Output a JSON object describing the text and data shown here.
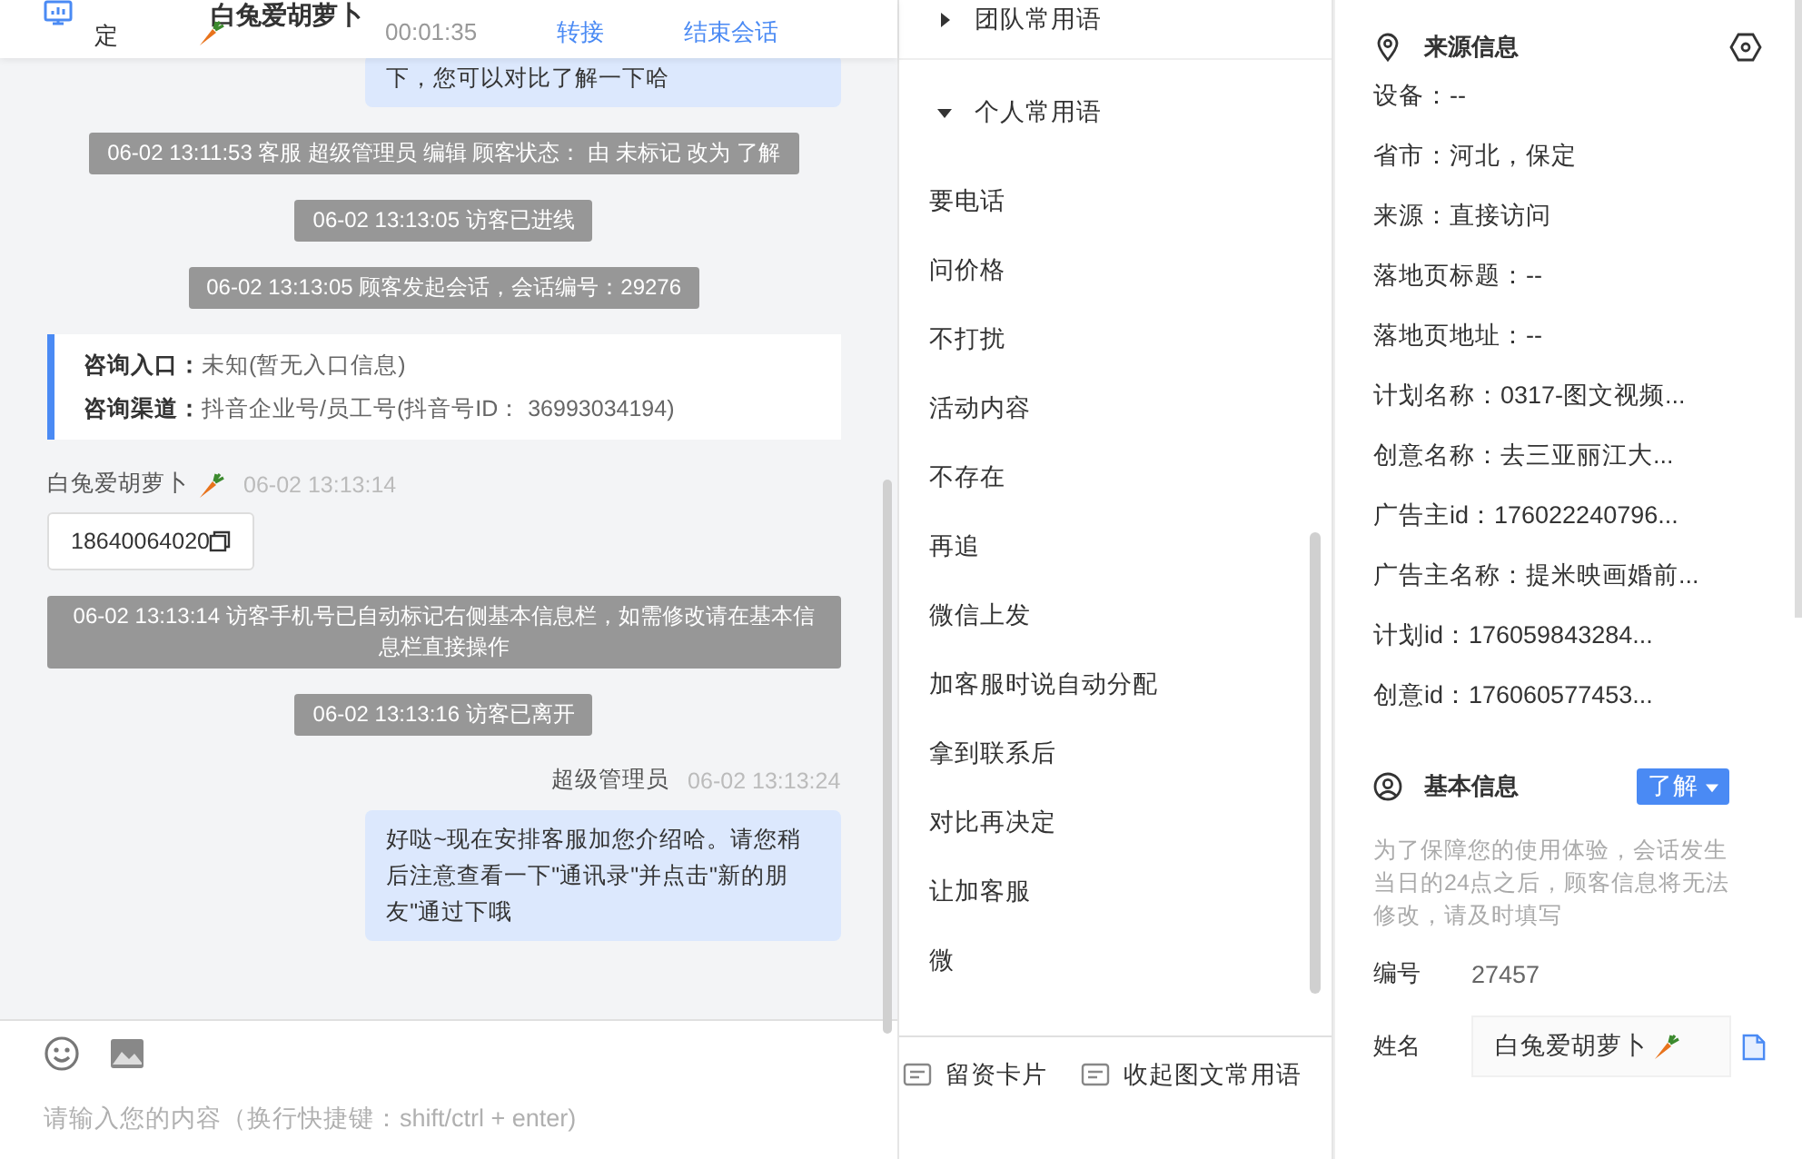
{
  "chat_header": {
    "location": "定",
    "visitor_name": "白兔爱胡萝卜",
    "session_time": "00:01:35",
    "actions": [
      "转接",
      "结束会话"
    ]
  },
  "chat": {
    "messages": [
      {
        "kind": "agent",
        "text": "下，您可以对比了解一下哈"
      },
      {
        "kind": "system",
        "text": "06-02 13:11:53 客服 超级管理员 编辑 顾客状态： 由 未标记 改为 了解"
      },
      {
        "kind": "system",
        "text": "06-02 13:13:05 访客已进线"
      },
      {
        "kind": "system",
        "text": "06-02 13:13:05 顾客发起会话，会话编号：29276"
      },
      {
        "kind": "info",
        "lines": [
          {
            "label": "咨询入口：",
            "value": "未知(暂无入口信息)"
          },
          {
            "label": "咨询渠道：",
            "value": "抖音企业号/员工号(抖音号ID： 36993034194)"
          }
        ]
      },
      {
        "kind": "visitor",
        "sender": "白兔爱胡萝卜",
        "time": "06-02 13:13:14",
        "text": "18640064020"
      },
      {
        "kind": "system",
        "text": "06-02 13:13:14 访客手机号已自动标记右侧基本信息栏，如需修改请在基本信息栏直接操作"
      },
      {
        "kind": "system",
        "text": "06-02 13:13:16 访客已离开"
      },
      {
        "kind": "agent",
        "sender": "超级管理员",
        "time": "06-02 13:13:24",
        "text": "好哒~现在安排客服加您介绍哈。请您稍后注意查看一下\"通讯录\"并点击\"新的朋友\"通过下哦"
      }
    ]
  },
  "composer": {
    "placeholder": "请输入您的内容（换行快捷键：shift/ctrl + enter)"
  },
  "phrases": {
    "groups": [
      {
        "title": "团队常用语",
        "expanded": false
      },
      {
        "title": "个人常用语",
        "expanded": true,
        "items": [
          "要电话",
          "问价格",
          "不打扰",
          "活动内容",
          "不存在",
          "再追",
          "微信上发",
          "加客服时说自动分配",
          "拿到联系后",
          "对比再决定",
          "让加客服",
          "微"
        ]
      }
    ],
    "bottom_actions": [
      "留资卡片",
      "收起图文常用语"
    ]
  },
  "source_info": {
    "title": "来源信息",
    "rows": [
      "设备：--",
      "省市：河北，保定",
      "来源：直接访问",
      "落地页标题：--",
      "落地页地址：--",
      "计划名称：0317-图文视频...",
      "创意名称：去三亚丽江大...",
      "广告主id：176022240796...",
      "广告主名称：提米映画婚前...",
      "计划id：176059843284...",
      "创意id：176060577453..."
    ]
  },
  "basic_info": {
    "title": "基本信息",
    "status": "了解",
    "note": "为了保障您的使用体验，会话发生当日的24点之后，顾客信息将无法修改，请及时填写",
    "fields": [
      {
        "kind": "text",
        "label": "编号",
        "value": "27457"
      },
      {
        "kind": "input",
        "label": "姓名",
        "value": "白兔爱胡萝卜"
      }
    ]
  }
}
